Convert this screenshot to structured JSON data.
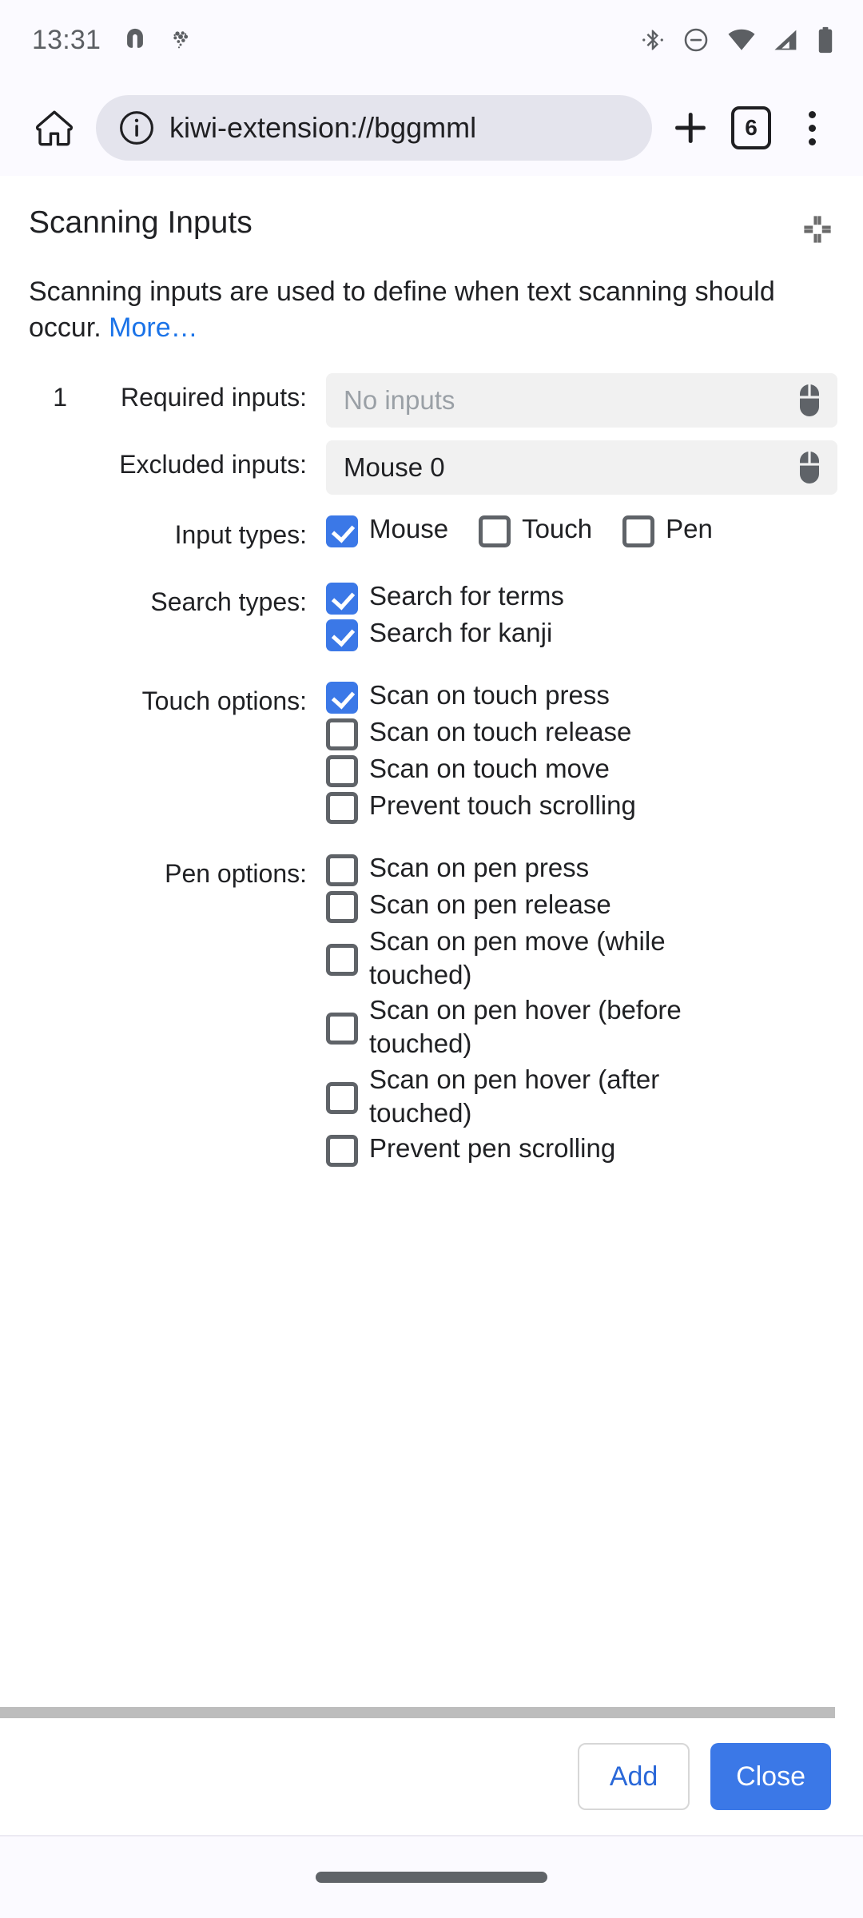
{
  "status_bar": {
    "clock": "13:31",
    "left_icons": [
      "app-horseshoe-icon",
      "app-balloon-icon"
    ],
    "right_icons": [
      "bluetooth-icon",
      "do-not-disturb-icon",
      "wifi-icon",
      "cellular-signal-icon",
      "battery-icon"
    ]
  },
  "browser": {
    "home_label": "home-icon",
    "site_info_label": "site-info-icon",
    "url": "kiwi-extension://bggmml",
    "new_tab_label": "new-tab-icon",
    "tab_count": "6",
    "menu_label": "overflow-menu-icon"
  },
  "page": {
    "title": "Scanning Inputs",
    "collapse_icon": "collapse-icon",
    "description": "Scanning inputs are used to define when text scanning should occur.",
    "more_link": "More…"
  },
  "form": {
    "index": "1",
    "required_inputs": {
      "label": "Required inputs:",
      "value": "No inputs",
      "is_placeholder": true,
      "icon": "mouse-icon"
    },
    "excluded_inputs": {
      "label": "Excluded inputs:",
      "value": "Mouse 0",
      "is_placeholder": false,
      "icon": "mouse-icon"
    },
    "input_types": {
      "label": "Input types:",
      "options": [
        {
          "label": "Mouse",
          "checked": true
        },
        {
          "label": "Touch",
          "checked": false
        },
        {
          "label": "Pen",
          "checked": false
        }
      ]
    },
    "search_types": {
      "label": "Search types:",
      "options": [
        {
          "label": "Search for terms",
          "checked": true
        },
        {
          "label": "Search for kanji",
          "checked": true
        }
      ]
    },
    "touch_options": {
      "label": "Touch options:",
      "options": [
        {
          "label": "Scan on touch press",
          "checked": true
        },
        {
          "label": "Scan on touch release",
          "checked": false
        },
        {
          "label": "Scan on touch move",
          "checked": false
        },
        {
          "label": "Prevent touch scrolling",
          "checked": false
        }
      ]
    },
    "pen_options": {
      "label": "Pen options:",
      "options": [
        {
          "label": "Scan on pen press",
          "checked": false
        },
        {
          "label": "Scan on pen release",
          "checked": false
        },
        {
          "label": "Scan on pen move (while touched)",
          "checked": false
        },
        {
          "label": "Scan on pen hover (before touched)",
          "checked": false
        },
        {
          "label": "Scan on pen hover (after touched)",
          "checked": false
        },
        {
          "label": "Prevent pen scrolling",
          "checked": false
        }
      ]
    }
  },
  "actions": {
    "add_label": "Add",
    "close_label": "Close"
  },
  "colors": {
    "accent_blue": "#3b78e7",
    "link_blue": "#1a73e8",
    "field_grey": "#f1f1f1",
    "placeholder_grey": "#9aa0a6",
    "text": "#202124"
  }
}
